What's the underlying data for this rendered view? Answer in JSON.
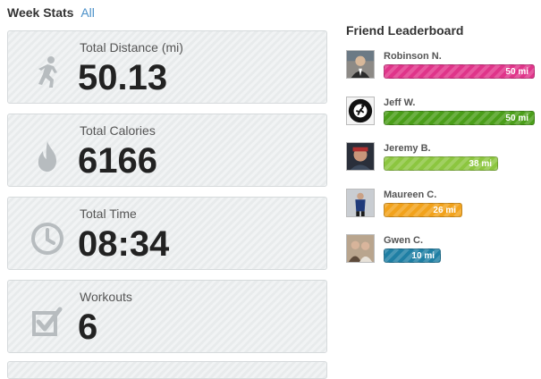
{
  "header": {
    "title": "Week Stats",
    "link": "All"
  },
  "stats": [
    {
      "label": "Total Distance (mi)",
      "value": "50.13",
      "icon": "runner-icon"
    },
    {
      "label": "Total Calories",
      "value": "6166",
      "icon": "flame-icon"
    },
    {
      "label": "Total Time",
      "value": "08:34",
      "icon": "clock-icon"
    },
    {
      "label": "Workouts",
      "value": "6",
      "icon": "checkbox-icon"
    }
  ],
  "leaderboard": {
    "title": "Friend Leaderboard",
    "friends": [
      {
        "name": "Robinson N.",
        "value_label": "50 mi",
        "miles": 50,
        "color": "#e0348a"
      },
      {
        "name": "Jeff W.",
        "value_label": "50 mi",
        "miles": 50,
        "color": "#4a9e19"
      },
      {
        "name": "Jeremy B.",
        "value_label": "38 mi",
        "miles": 38,
        "color": "#8cc63f"
      },
      {
        "name": "Maureen C.",
        "value_label": "26 mi",
        "miles": 26,
        "color": "#f2a21b"
      },
      {
        "name": "Gwen C.",
        "value_label": "10 mi",
        "miles": 10,
        "color": "#1f7fa4"
      }
    ]
  }
}
